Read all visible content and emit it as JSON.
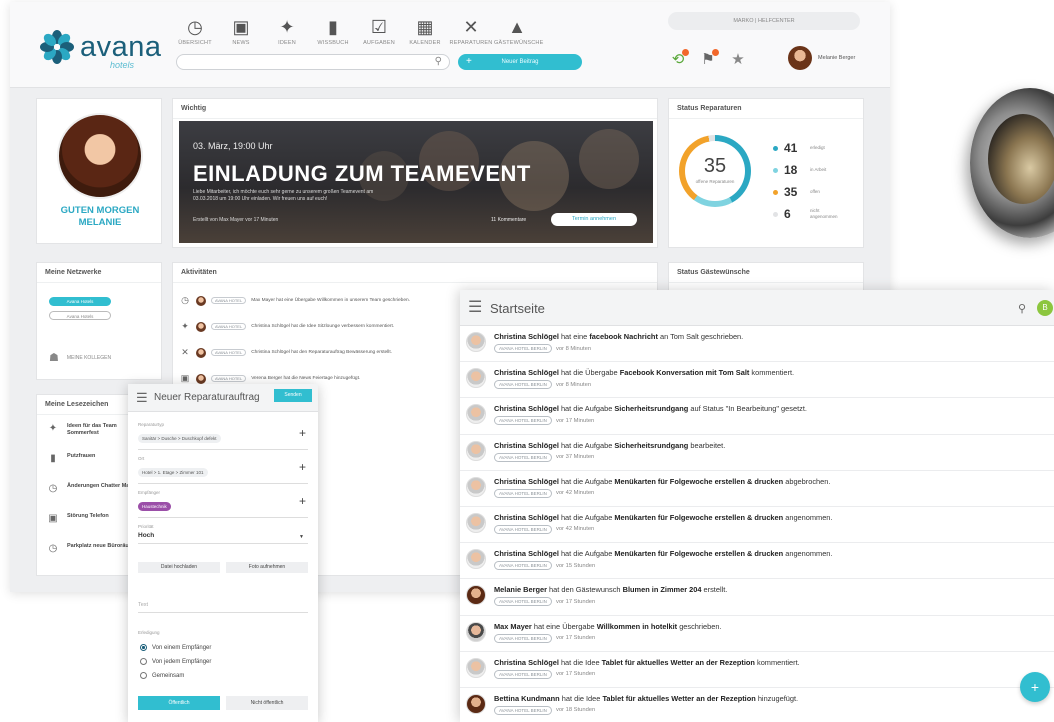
{
  "brand": {
    "name": "avana",
    "sub": "hotels",
    "colors": {
      "primary": "#1b5f7a",
      "accent": "#31bed0",
      "orange": "#f2a22a"
    }
  },
  "nav": [
    {
      "label": "ÜBERSICHT",
      "icon": "clock-icon",
      "glyph": "◷"
    },
    {
      "label": "NEWS",
      "icon": "chat-icon",
      "glyph": "▣"
    },
    {
      "label": "IDEEN",
      "icon": "lightbulb-icon",
      "glyph": "✦"
    },
    {
      "label": "WISSBUCH",
      "icon": "book-icon",
      "glyph": "▮"
    },
    {
      "label": "AUFGABEN",
      "icon": "clipboard-icon",
      "glyph": "☑"
    },
    {
      "label": "KALENDER",
      "icon": "calendar-icon",
      "glyph": "▦"
    },
    {
      "label": "REPARATUREN",
      "icon": "tools-icon",
      "glyph": "✕"
    },
    {
      "label": "GÄSTEWÜNSCHE",
      "icon": "bell-icon",
      "glyph": "▲"
    }
  ],
  "search": {
    "placeholder": ""
  },
  "new_button": "Neuer Beitrag",
  "hotel_select": "MARKO | HELFCENTER",
  "user": {
    "name": "Melanie Berger"
  },
  "greeting": {
    "line1": "GUTEN MORGEN",
    "line2": "MELANIE"
  },
  "wichtig": {
    "title": "Wichtig",
    "date": "03. März, 19:00 Uhr",
    "headline": "EINLADUNG ZUM TEAMEVENT",
    "desc": "Liebe Mitarbeiter, ich möchte euch sehr gerne zu unserem großen Teamevent am 03.03.2018 um 19:00 Uhr einladen. Wir freuen uns auf euch!",
    "meta": "Erstellt von Max Mayer vor 17 Minuten",
    "comments": "11 Kommentare",
    "action": "Termin annehmen"
  },
  "repairs": {
    "title": "Status Reparaturen",
    "total": "35",
    "total_label": "offene Reparaturen",
    "stats": [
      {
        "value": "41",
        "label": "erledigt",
        "color": "#2ba8c3"
      },
      {
        "value": "18",
        "label": "in Arbeit",
        "color": "#7fd3e0"
      },
      {
        "value": "35",
        "label": "offen",
        "color": "#f2a22a"
      },
      {
        "value": "6",
        "label": "nicht angenommen",
        "color": "#e2e3e5"
      }
    ]
  },
  "networks": {
    "title": "Meine Netzwerke",
    "primary": "Avana Hotels",
    "secondary": "Avana Hotels",
    "colleagues": "MEINE KOLLEGEN"
  },
  "bookmarks": {
    "title": "Meine Lesezeichen",
    "items": [
      {
        "icon": "lightbulb-icon",
        "glyph": "✦",
        "text": "Ideen für das Team Sommerfest"
      },
      {
        "icon": "book-icon",
        "glyph": "▮",
        "text": "Putzfrauen"
      },
      {
        "icon": "clock-icon",
        "glyph": "◷",
        "text": "Änderungen Chatter Manager"
      },
      {
        "icon": "chat-icon",
        "glyph": "▣",
        "text": "Störung Telefon"
      },
      {
        "icon": "clock-icon",
        "glyph": "◷",
        "text": "Parkplatz neue Büroräume"
      }
    ]
  },
  "activities": {
    "title": "Aktivitäten",
    "rows": [
      {
        "icon": "clock-icon",
        "glyph": "◷",
        "tag": "AVANA HOTEL",
        "text": "Max Mayer hat eine Übergabe Willkommen in unserem Team geschrieben."
      },
      {
        "icon": "lightbulb-icon",
        "glyph": "✦",
        "tag": "AVANA HOTEL",
        "text": "Christina Schlögel hat die Idee Sitzlounge verbessern kommentiert."
      },
      {
        "icon": "tools-icon",
        "glyph": "✕",
        "tag": "AVANA HOTEL",
        "text": "Christina Schlögel hat den Reparaturauftrag Bewässerung erstellt."
      },
      {
        "icon": "chat-icon",
        "glyph": "▣",
        "tag": "AVANA HOTEL",
        "text": "Verena Berger hat die News Feiertage hinzugefügt."
      }
    ]
  },
  "form": {
    "title": "Neuer Reparaturauftrag",
    "send": "Senden",
    "fields": [
      {
        "label": "Reparaturtyp",
        "value": "Sanitär > Dusche > Duschkopf defekt",
        "chip": "default"
      },
      {
        "label": "Ort",
        "value": "Hotel > 1. Etage > Zimmer 101",
        "chip": "default"
      },
      {
        "label": "Empfänger",
        "value": "Haustechnik",
        "chip": "purple"
      }
    ],
    "priority_label": "Priorität",
    "priority_value": "Hoch",
    "upload": "Datei hochladen",
    "photo": "Foto aufnehmen",
    "text_placeholder": "Text",
    "completion_label": "Erledigung",
    "options": [
      "Von einem Empfänger",
      "Von jedem Empfänger",
      "Gemeinsam"
    ],
    "selected_option": 0,
    "footer_left": "Öffentlich",
    "footer_right": "Nicht öffentlich"
  },
  "start": {
    "title": "Startseite",
    "avatar_letter": "B",
    "tag": "AVANA HOTEL BERLIN",
    "items": [
      {
        "avatar": "light",
        "actor": "Christina Schlögel",
        "pre": " hat eine ",
        "obj": "facebook Nachricht",
        "post": " an Tom Salt geschrieben.",
        "time": "vor 8 Minuten"
      },
      {
        "avatar": "light",
        "actor": "Christina Schlögel",
        "pre": " hat die Übergabe ",
        "obj": "Facebook Konversation mit Tom Salt",
        "post": " kommentiert.",
        "time": "vor 8 Minuten"
      },
      {
        "avatar": "light",
        "actor": "Christina Schlögel",
        "pre": " hat die Aufgabe ",
        "obj": "Sicherheitsrundgang",
        "post": " auf Status \"In Bearbeitung\" gesetzt.",
        "time": "vor 17 Minuten"
      },
      {
        "avatar": "light",
        "actor": "Christina Schlögel",
        "pre": " hat die Aufgabe ",
        "obj": "Sicherheitsrundgang",
        "post": " bearbeitet.",
        "time": "vor 37 Minuten"
      },
      {
        "avatar": "light",
        "actor": "Christina Schlögel",
        "pre": " hat die Aufgabe ",
        "obj": "Menükarten für Folgewoche erstellen & drucken",
        "post": " abgebrochen.",
        "time": "vor 42 Minuten"
      },
      {
        "avatar": "light",
        "actor": "Christina Schlögel",
        "pre": " hat die Aufgabe ",
        "obj": "Menükarten für Folgewoche erstellen & drucken",
        "post": " angenommen.",
        "time": "vor 42 Minuten"
      },
      {
        "avatar": "light",
        "actor": "Christina Schlögel",
        "pre": " hat die Aufgabe ",
        "obj": "Menükarten für Folgewoche erstellen & drucken",
        "post": " angenommen.",
        "time": "vor 15 Stunden"
      },
      {
        "avatar": "dark",
        "actor": "Melanie Berger",
        "pre": " hat den Gästewunsch ",
        "obj": "Blumen in Zimmer 204",
        "post": " erstellt.",
        "time": "vor 17 Stunden"
      },
      {
        "avatar": "male",
        "actor": "Max Mayer",
        "pre": " hat eine Übergabe ",
        "obj": "Willkommen in hotelkit",
        "post": " geschrieben.",
        "time": "vor 17 Stunden"
      },
      {
        "avatar": "light",
        "actor": "Christina Schlögel",
        "pre": " hat die Idee ",
        "obj": "Tablet für aktuelles Wetter an der Rezeption",
        "post": " kommentiert.",
        "time": "vor 17 Stunden"
      },
      {
        "avatar": "dark",
        "actor": "Bettina Kundmann",
        "pre": " hat die Idee ",
        "obj": "Tablet für aktuelles Wetter an der Rezeption",
        "post": " hinzugefügt.",
        "time": "vor 18 Stunden"
      }
    ]
  }
}
